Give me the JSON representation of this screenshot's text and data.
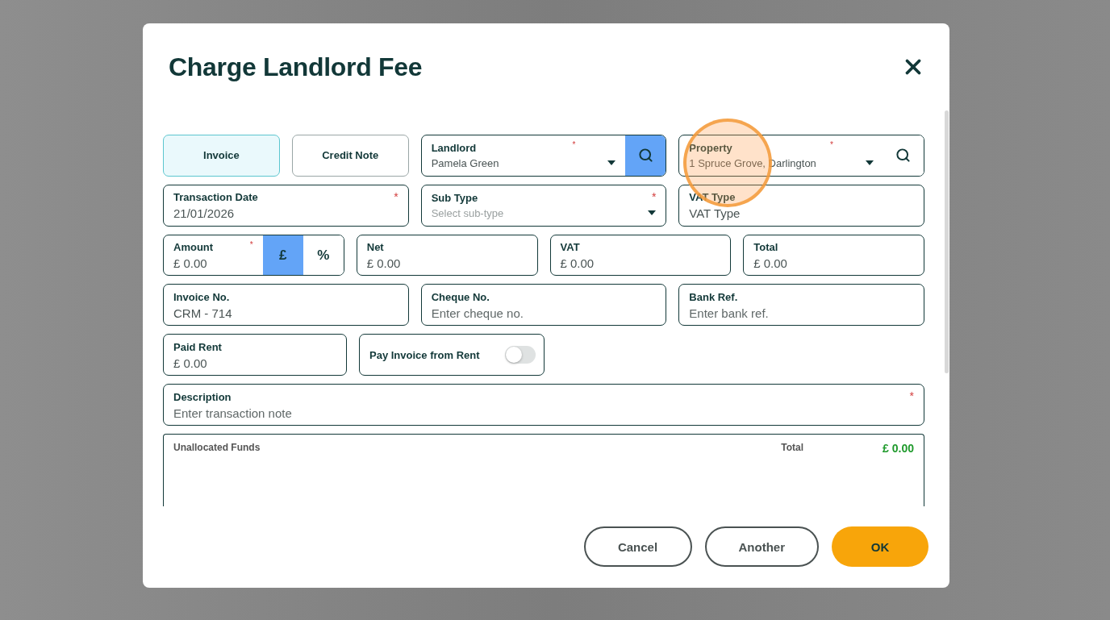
{
  "dialog": {
    "title": "Charge Landlord Fee"
  },
  "rows": [
    {
      "items": [
        {
          "kind": "choice",
          "options": [
            {
              "label": "Invoice",
              "selected": true
            },
            {
              "label": "Credit Note",
              "selected": false
            }
          ]
        },
        {
          "kind": "search_select",
          "label": "Landlord",
          "value": "Pamela Green",
          "required_mark": "*",
          "search_active": true
        },
        {
          "kind": "search_select",
          "label": "Property",
          "value": "1 Spruce Grove, Darlington",
          "required_mark": "*",
          "search_active": false
        }
      ]
    },
    {
      "items": [
        {
          "kind": "text",
          "label": "Transaction Date",
          "value": "21/01/2026",
          "required_mark": "*"
        },
        {
          "kind": "select",
          "label": "Sub Type",
          "placeholder": "Select sub-type",
          "required_mark": "*"
        },
        {
          "kind": "text",
          "label": "VAT Type",
          "value": "VAT Type"
        }
      ]
    },
    {
      "items": [
        {
          "kind": "amount",
          "label": "Amount",
          "value": "£ 0.00",
          "required_mark": "*",
          "modes": [
            {
              "label": "£",
              "selected": true
            },
            {
              "label": "%",
              "selected": false
            }
          ]
        },
        {
          "kind": "text",
          "label": "Net",
          "value": "£ 0.00"
        },
        {
          "kind": "text",
          "label": "VAT",
          "value": "£ 0.00"
        },
        {
          "kind": "text",
          "label": "Total",
          "value": "£ 0.00"
        }
      ]
    },
    {
      "items": [
        {
          "kind": "text",
          "label": "Invoice No.",
          "value": "CRM - 714"
        },
        {
          "kind": "text",
          "label": "Cheque No.",
          "placeholder": "Enter cheque no."
        },
        {
          "kind": "text",
          "label": "Bank Ref.",
          "placeholder": "Enter bank ref."
        }
      ]
    },
    {
      "items": [
        {
          "kind": "text",
          "label": "Paid Rent",
          "value": "£ 0.00"
        },
        {
          "kind": "toggle",
          "label": "Pay Invoice from Rent",
          "on": false
        }
      ]
    },
    {
      "items": [
        {
          "kind": "text",
          "label": "Description",
          "placeholder": "Enter transaction note",
          "required_mark": "*"
        }
      ]
    }
  ],
  "unallocated": {
    "label": "Unallocated Funds",
    "total_label": "Total",
    "total": "£ 0.00"
  },
  "buttons": [
    {
      "label": "Cancel",
      "primary": false
    },
    {
      "label": "Another",
      "primary": false
    },
    {
      "label": "OK",
      "primary": true
    }
  ]
}
